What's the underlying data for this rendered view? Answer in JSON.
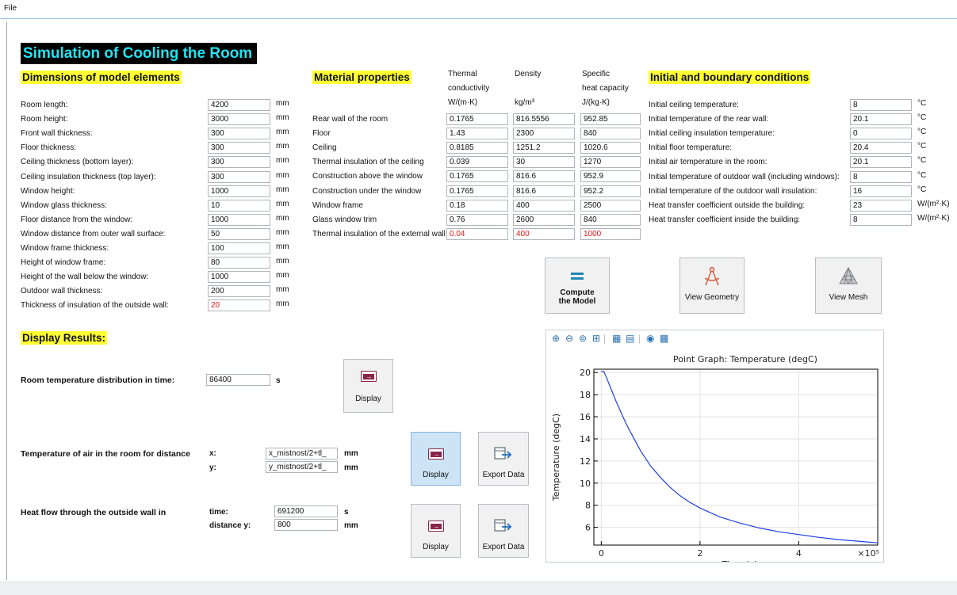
{
  "menu": {
    "file": "File"
  },
  "title": "Simulation of Cooling the Room",
  "dimensions": {
    "heading": "Dimensions of model elements",
    "rows": [
      {
        "label": "Room length:",
        "value": "4200",
        "unit": "mm"
      },
      {
        "label": "Room height:",
        "value": "3000",
        "unit": "mm"
      },
      {
        "label": "Front wall thickness:",
        "value": "300",
        "unit": "mm"
      },
      {
        "label": "Floor thickness:",
        "value": "300",
        "unit": "mm"
      },
      {
        "label": "Ceiling thickness (bottom layer):",
        "value": "300",
        "unit": "mm"
      },
      {
        "label": "Ceiling insulation thickness (top layer):",
        "value": "300",
        "unit": "mm"
      },
      {
        "label": "Window height:",
        "value": "1000",
        "unit": "mm"
      },
      {
        "label": "Window glass thickness:",
        "value": "10",
        "unit": "mm"
      },
      {
        "label": "Floor distance from the window:",
        "value": "1000",
        "unit": "mm"
      },
      {
        "label": "Window distance from outer wall surface:",
        "value": "50",
        "unit": "mm"
      },
      {
        "label": "Window frame thickness:",
        "value": "100",
        "unit": "mm"
      },
      {
        "label": "Height of window frame:",
        "value": "80",
        "unit": "mm"
      },
      {
        "label": "Height of the wall below the window:",
        "value": "1000",
        "unit": "mm"
      },
      {
        "label": "Outdoor wall thickness:",
        "value": "200",
        "unit": "mm"
      },
      {
        "label": "Thickness of insulation of the outside wall:",
        "value": "20",
        "unit": "mm"
      }
    ]
  },
  "material": {
    "heading": "Material properties",
    "col1_header": [
      "Thermal",
      "conductivity",
      "W/(m·K)"
    ],
    "col2_header": [
      "Density",
      "",
      "kg/m³"
    ],
    "col3_header": [
      "Specific",
      "heat capacity",
      "J/(kg·K)"
    ],
    "rows": [
      {
        "label": "Rear wall of the room",
        "k": "0.1765",
        "rho": "816.5556",
        "cp": "952.85"
      },
      {
        "label": "Floor",
        "k": "1.43",
        "rho": "2300",
        "cp": "840"
      },
      {
        "label": "Ceiling",
        "k": "0.8185",
        "rho": "1251.2",
        "cp": "1020.6"
      },
      {
        "label": "Thermal insulation of the ceiling",
        "k": "0.039",
        "rho": "30",
        "cp": "1270"
      },
      {
        "label": "Construction above the window",
        "k": "0.1765",
        "rho": "816.6",
        "cp": "952.9"
      },
      {
        "label": "Construction under the window",
        "k": "0.1765",
        "rho": "816.6",
        "cp": "952.2"
      },
      {
        "label": "Window frame",
        "k": "0.18",
        "rho": "400",
        "cp": "2500"
      },
      {
        "label": "Glass window trim",
        "k": "0.76",
        "rho": "2600",
        "cp": "840"
      },
      {
        "label": "Thermal insulation of the external wall",
        "k": "0.04",
        "rho": "400",
        "cp": "1000"
      }
    ]
  },
  "initial": {
    "heading": "Initial and boundary conditions",
    "rows": [
      {
        "label": "Initial ceiling temperature:",
        "value": "8",
        "unit": "°C"
      },
      {
        "label": "Initial temperature of the rear wall:",
        "value": "20.1",
        "unit": "°C"
      },
      {
        "label": "Initial ceiling insulation temperature:",
        "value": "0",
        "unit": "°C"
      },
      {
        "label": "Initial floor temperature:",
        "value": "20.4",
        "unit": "°C"
      },
      {
        "label": "Initial air temperature in the room:",
        "value": "20.1",
        "unit": "°C"
      },
      {
        "label": "Initial temperature of outdoor wall (including windows):",
        "value": "8",
        "unit": "°C"
      },
      {
        "label": "Initial temperature of the outdoor wall insulation:",
        "value": "16",
        "unit": "°C"
      },
      {
        "label": "Heat transfer coefficient outside the building:",
        "value": "23",
        "unit": "W/(m²·K)"
      },
      {
        "label": "Heat transfer coefficient inside the building:",
        "value": "8",
        "unit": "W/(m²·K)"
      }
    ]
  },
  "buttons": {
    "compute": "Compute the Model",
    "view_geometry": "View Geometry",
    "view_mesh": "View Mesh",
    "display": "Display",
    "export": "Export Data"
  },
  "results": {
    "heading": "Display Results:",
    "room_temp_label": "Room temperature distribution in time:",
    "room_temp_value": "86400",
    "room_temp_unit": "s",
    "air_temp_label": "Temperature of air in the room for distance",
    "x_label": "x:",
    "x_value": "x_mistnost/2+tl_",
    "x_unit": "mm",
    "y_label": "y:",
    "y_value": "y_mistnost/2+tl_",
    "y_unit": "mm",
    "heat_flow_label": "Heat flow through the outside wall in",
    "time_label": "time:",
    "time_value": "691200",
    "time_unit": "s",
    "dist_label": "distance y:",
    "dist_value": "800",
    "dist_unit": "mm"
  },
  "chart_data": {
    "type": "line",
    "title": "Point Graph: Temperature (degC)",
    "xlabel": "Time (s)",
    "ylabel": "Temperature (degC)",
    "x_multiplier": "×10⁵",
    "xlim": [
      -0.15,
      5.6
    ],
    "ylim": [
      4.4,
      20.3
    ],
    "x_ticks": [
      0,
      2,
      4,
      6
    ],
    "y_ticks": [
      6,
      8,
      10,
      12,
      14,
      16,
      18,
      20
    ],
    "grid": true,
    "series": [
      {
        "x": [
          0,
          0.05,
          0.1,
          0.2,
          0.3,
          0.4,
          0.5,
          0.6,
          0.8,
          1.0,
          1.2,
          1.4,
          1.6,
          1.8,
          2.0,
          2.4,
          2.8,
          3.2,
          3.6,
          4.0,
          4.4,
          4.8,
          5.2,
          5.6
        ],
        "y": [
          20.1,
          20.1,
          19.6,
          18.5,
          17.4,
          16.4,
          15.4,
          14.55,
          12.9,
          11.55,
          10.5,
          9.6,
          8.85,
          8.25,
          7.75,
          6.95,
          6.4,
          5.95,
          5.6,
          5.35,
          5.1,
          4.9,
          4.75,
          4.6
        ],
        "color": "#1f3fe0"
      }
    ]
  }
}
